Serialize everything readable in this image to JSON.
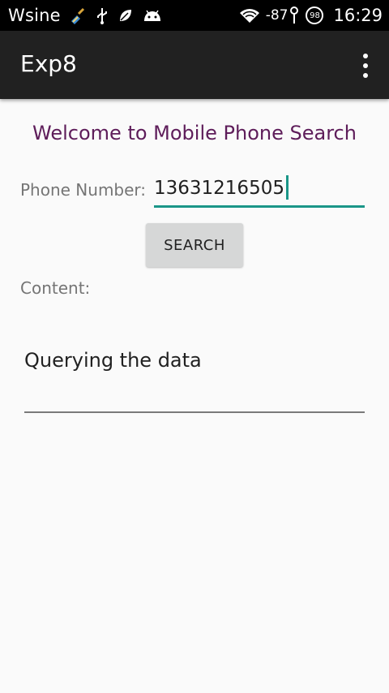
{
  "status_bar": {
    "carrier": "Wsine",
    "icons": [
      "clean-broom-icon",
      "usb-icon",
      "leaf-icon",
      "android-icon",
      "wifi-icon",
      "signal-icon",
      "battery-icon"
    ],
    "signal": "-87",
    "battery": "98",
    "time": "16:29"
  },
  "app_bar": {
    "title": "Exp8",
    "menu_icon": "overflow-menu-icon"
  },
  "main": {
    "welcome": "Welcome to Mobile Phone Search",
    "phone_label": "Phone Number:",
    "phone_value": "13631216505",
    "search_label": "SEARCH",
    "content_label": "Content:",
    "content_text": "Querying the data"
  },
  "colors": {
    "status_bar_bg": "#000000",
    "app_bar_bg": "#212121",
    "accent": "#1a9688",
    "welcome_text": "#5e1d5a",
    "background": "#fafafa"
  }
}
